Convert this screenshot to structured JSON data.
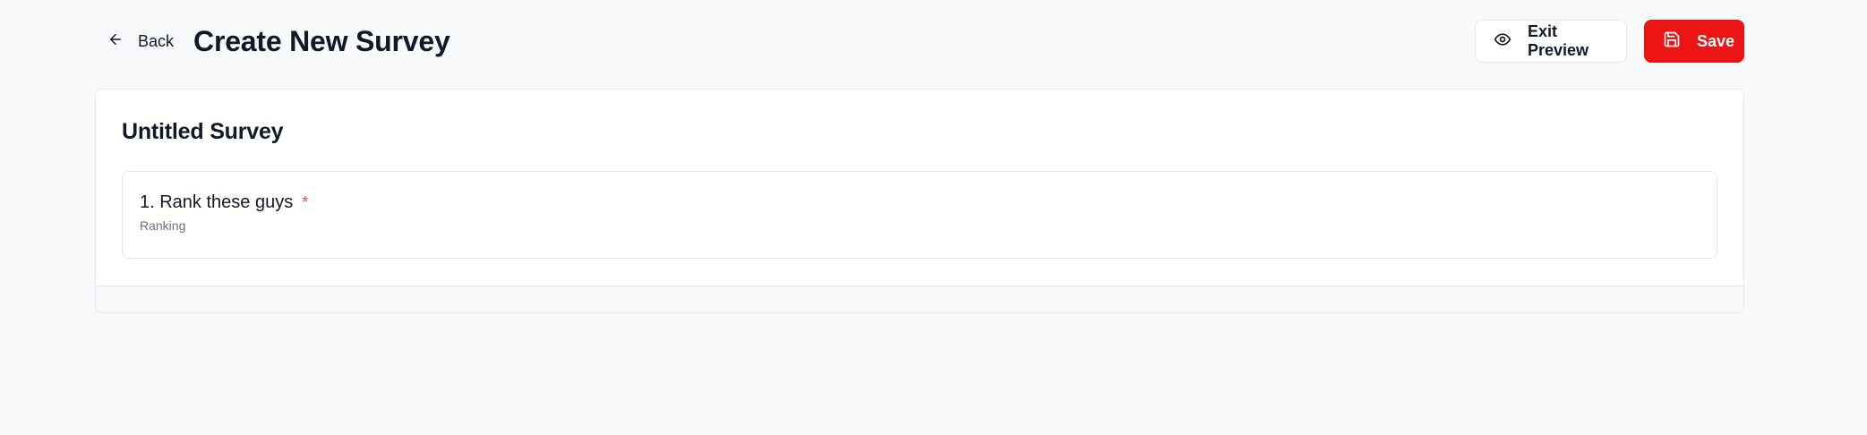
{
  "header": {
    "back_label": "Back",
    "title": "Create New Survey",
    "exit_preview_label": "Exit Preview",
    "save_label": "Save"
  },
  "survey": {
    "title": "Untitled Survey",
    "questions": [
      {
        "title": "1. Rank these guys",
        "required_marker": "*",
        "type": "Ranking"
      }
    ]
  },
  "icons": {
    "back": "arrow-left-icon",
    "exit_preview": "eye-icon",
    "save": "save-icon"
  },
  "colors": {
    "accent": "#ec1515",
    "required": "#ef4444",
    "background": "#f8f9fb"
  }
}
